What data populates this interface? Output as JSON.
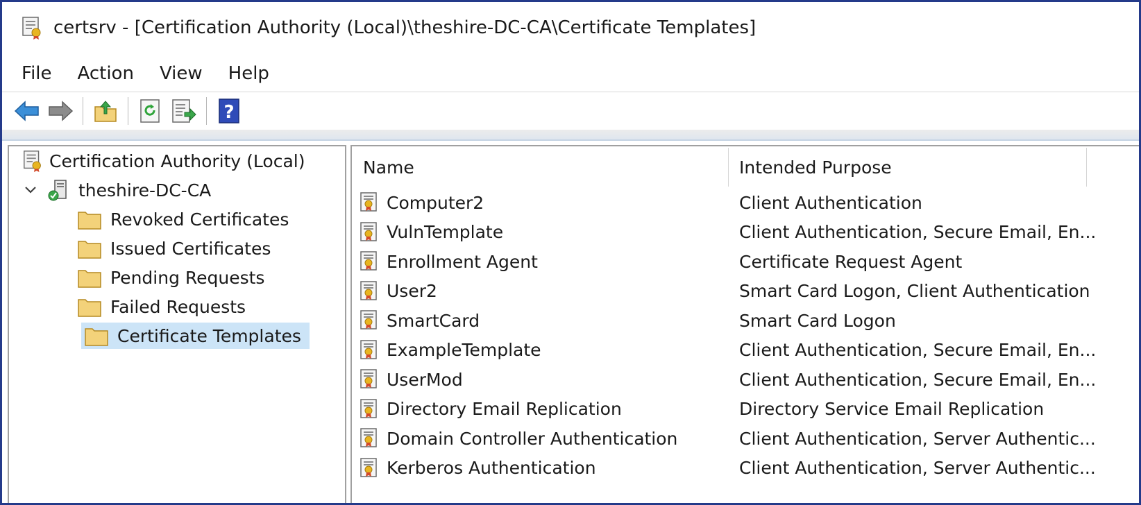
{
  "window": {
    "title": "certsrv - [Certification Authority (Local)\\theshire-DC-CA\\Certificate Templates]"
  },
  "menu": [
    "File",
    "Action",
    "View",
    "Help"
  ],
  "toolbar": {
    "icons": [
      "back-arrow-icon",
      "forward-arrow-icon",
      "up-folder-icon",
      "refresh-icon",
      "export-list-icon",
      "help-icon"
    ],
    "help_glyph": "?"
  },
  "tree": {
    "root": "Certification Authority (Local)",
    "ca": "theshire-DC-CA",
    "children": [
      "Revoked Certificates",
      "Issued Certificates",
      "Pending Requests",
      "Failed Requests",
      "Certificate Templates"
    ],
    "selected": "Certificate Templates"
  },
  "list": {
    "columns": [
      "Name",
      "Intended Purpose"
    ],
    "rows": [
      {
        "name": "Computer2",
        "purpose": "Client Authentication"
      },
      {
        "name": "VulnTemplate",
        "purpose": "Client Authentication, Secure Email, En..."
      },
      {
        "name": "Enrollment Agent",
        "purpose": "Certificate Request Agent"
      },
      {
        "name": "User2",
        "purpose": "Smart Card Logon, Client Authentication"
      },
      {
        "name": "SmartCard",
        "purpose": "Smart Card Logon"
      },
      {
        "name": "ExampleTemplate",
        "purpose": "Client Authentication, Secure Email, En..."
      },
      {
        "name": "UserMod",
        "purpose": "Client Authentication, Secure Email, En..."
      },
      {
        "name": "Directory Email Replication",
        "purpose": "Directory Service Email Replication"
      },
      {
        "name": "Domain Controller Authentication",
        "purpose": "Client Authentication, Server Authentic..."
      },
      {
        "name": "Kerberos Authentication",
        "purpose": "Client Authentication, Server Authentic..."
      }
    ]
  },
  "colors": {
    "window_border": "#243a8a",
    "selection": "#cce4f7",
    "arrow_blue": "#3b8fd8",
    "help_blue": "#2f4bb8",
    "folder": "#f3d27a"
  }
}
